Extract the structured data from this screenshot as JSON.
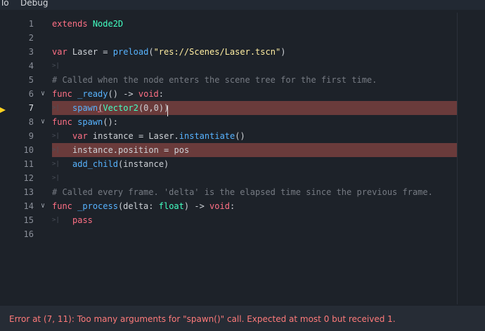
{
  "menubar": {
    "items": [
      "To",
      "Debug"
    ]
  },
  "editor": {
    "line_numbers": [
      "1",
      "2",
      "3",
      "4",
      "5",
      "6",
      "7",
      "8",
      "9",
      "10",
      "11",
      "12",
      "13",
      "14",
      "15",
      "16"
    ],
    "lines": {
      "l1": {
        "kw": "extends",
        "type": "Node2D"
      },
      "l3": {
        "kw": "var",
        "name": "Laser",
        "eq": "=",
        "fn": "preload",
        "open": "(",
        "str": "\"res://Scenes/Laser.tscn\"",
        "close": ")"
      },
      "l5": {
        "comment": "# Called when the node enters the scene tree for the first time."
      },
      "l6": {
        "kw": "func",
        "name": "_ready",
        "paren": "()",
        "arrow": "->",
        "ret": "void",
        "colon": ":"
      },
      "l7": {
        "fn": "spawn",
        "open": "(",
        "type": "Vector2",
        "args": "(0,0)",
        "close": ")"
      },
      "l8": {
        "kw": "func",
        "name": "spawn",
        "paren": "():"
      },
      "l9": {
        "kw": "var",
        "name": "instance",
        "eq": "=",
        "obj": "Laser",
        "dot": ".",
        "fn": "instantiate",
        "paren": "()"
      },
      "l10": {
        "text": "instance.position = pos"
      },
      "l11": {
        "fn": "add_child",
        "args": "(instance)"
      },
      "l13": {
        "comment": "# Called every frame. 'delta' is the elapsed time since the previous frame."
      },
      "l14": {
        "kw": "func",
        "name": "_process",
        "open": "(delta:",
        "type": "float",
        "close": ")",
        "arrow": "->",
        "ret": "void",
        "colon": ":"
      },
      "l15": {
        "kw": "pass"
      }
    }
  },
  "status": {
    "error": "Error at (7, 11): Too many arguments for \"spawn()\" call. Expected at most 0 but received 1."
  },
  "colors": {
    "background": "#1d2229",
    "highlight": "#6a3b3b",
    "keyword": "#ff7085",
    "type": "#42ffc2",
    "function": "#57b3ff",
    "string": "#ffeda1",
    "comment": "#767b83",
    "error": "#ff7a7a",
    "exec_arrow": "#ffd21f"
  },
  "icons": {
    "fold": "chevron-down-icon",
    "tab": "tab-indent-icon",
    "exec": "execution-arrow-icon"
  }
}
